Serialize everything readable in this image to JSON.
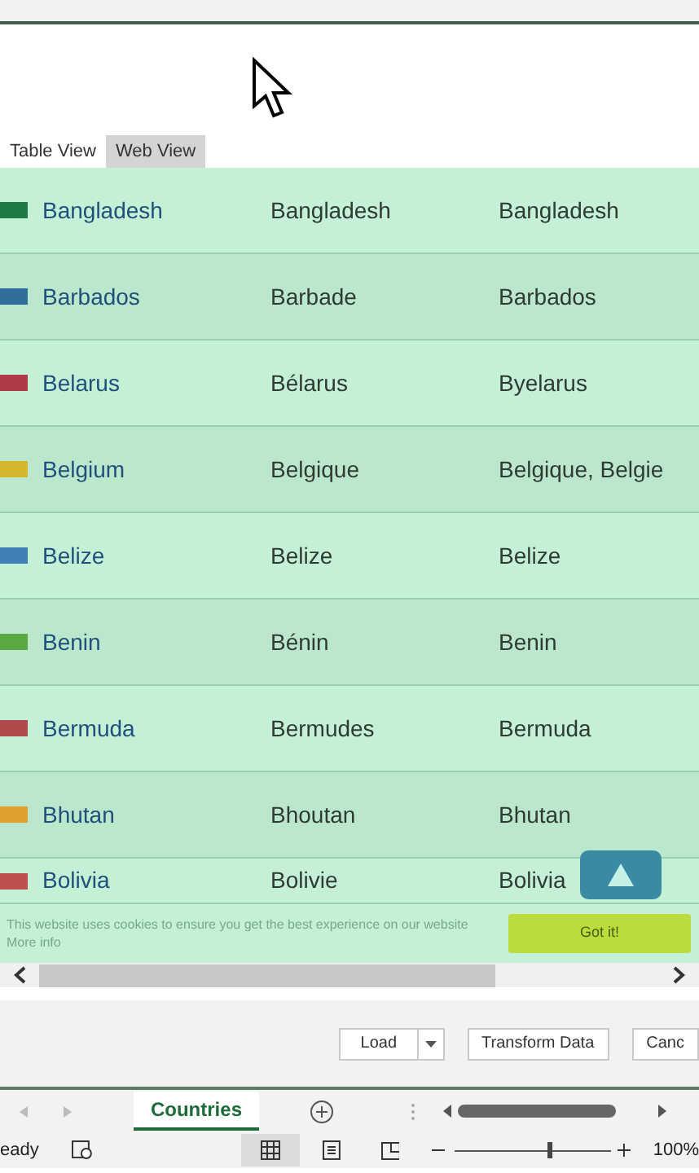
{
  "view_tabs": [
    {
      "label": "Table View",
      "selected": false
    },
    {
      "label": "Web View",
      "selected": true
    }
  ],
  "rows": [
    {
      "color": "#1e7a46",
      "cells": [
        "Bangladesh",
        "Bangladesh",
        "Bangladesh"
      ]
    },
    {
      "color": "#2f6f9a",
      "cells": [
        "Barbados",
        "Barbade",
        "Barbados"
      ]
    },
    {
      "color": "#b03a48",
      "cells": [
        "Belarus",
        "Bélarus",
        "Byelarus"
      ]
    },
    {
      "color": "#d4b62a",
      "cells": [
        "Belgium",
        "Belgique",
        "Belgique, Belgie"
      ]
    },
    {
      "color": "#3e7fb8",
      "cells": [
        "Belize",
        "Belize",
        "Belize"
      ]
    },
    {
      "color": "#5aa842",
      "cells": [
        "Benin",
        "Bénin",
        "Benin"
      ]
    },
    {
      "color": "#b04a4a",
      "cells": [
        "Bermuda",
        "Bermudes",
        "Bermuda"
      ]
    },
    {
      "color": "#e0a030",
      "cells": [
        "Bhutan",
        "Bhoutan",
        "Bhutan"
      ]
    },
    {
      "color": "#c0504d",
      "cells": [
        "Bolivia",
        "Bolivie",
        "Bolivia"
      ]
    }
  ],
  "cookie_banner": {
    "text": "This website uses cookies to ensure you get the best experience on our website More info",
    "button": "Got it!"
  },
  "dialog_buttons": [
    "Load",
    "Transform Data",
    "Canc"
  ],
  "sheet_tabs": [
    {
      "label": "Countries",
      "selected": true
    }
  ],
  "status_bar": {
    "status": "eady",
    "zoom": "100%",
    "level": 0.6
  }
}
